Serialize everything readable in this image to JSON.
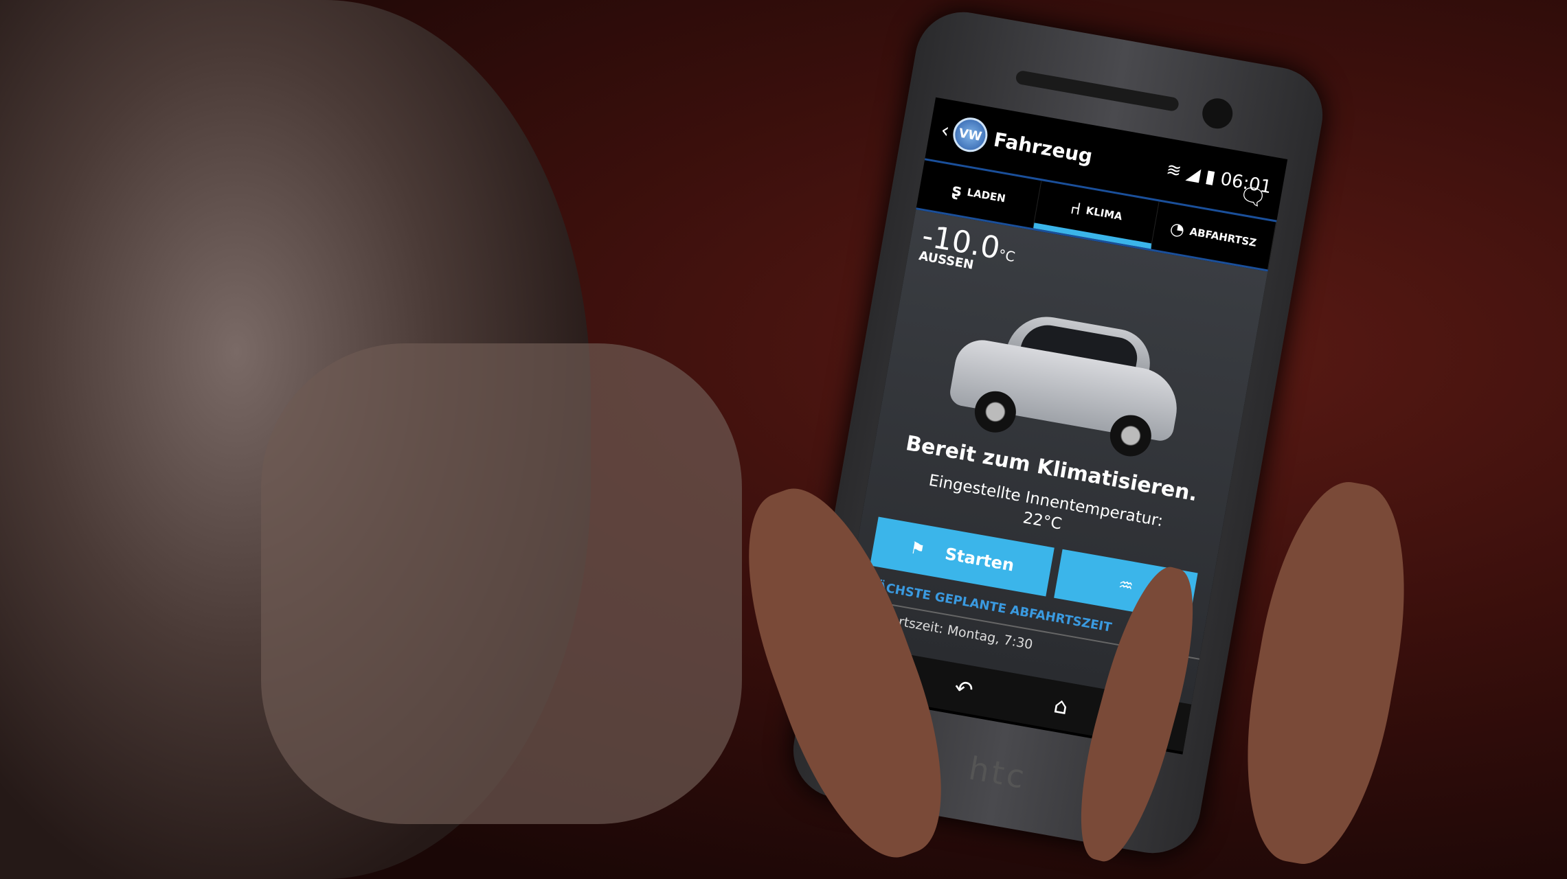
{
  "status_bar": {
    "time": "06:01",
    "icons": [
      "wifi-icon",
      "signal-icon",
      "battery-icon"
    ]
  },
  "header": {
    "back": "‹",
    "logo": "VW",
    "title": "Fahrzeug"
  },
  "tabs": [
    {
      "label": "LADEN",
      "icon": "charging-plug-icon"
    },
    {
      "label": "KLIMA",
      "icon": "climate-seat-icon",
      "active": true
    },
    {
      "label": "ABFAHRTSZ",
      "icon": "departure-timer-icon"
    }
  ],
  "climate": {
    "outside_temp": "-10.0",
    "unit": "°C",
    "outside_label": "AUSSEN",
    "status": "Bereit zum Klimatisieren.",
    "set_label": "Eingestellte Innentemperatur:",
    "set_temp": "22°C"
  },
  "buttons": {
    "start": "Starten"
  },
  "departure": {
    "section_title": "NÄCHSTE GEPLANTE ABFAHRTSZEIT",
    "text": "Abfahrtszeit: Montag, 7:30"
  },
  "device": {
    "brand": "htc"
  },
  "colors": {
    "accent": "#3bb5ea",
    "tab_line": "#1a4f9a",
    "link": "#3a9ae0"
  }
}
